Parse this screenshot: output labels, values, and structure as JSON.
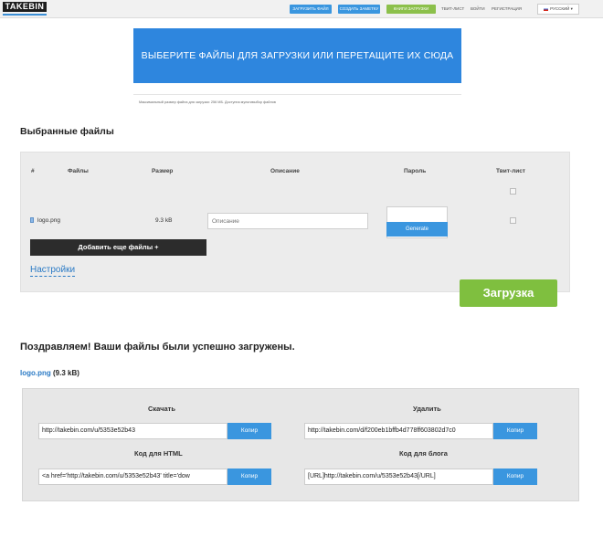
{
  "topbar": {
    "logo_text": "TAKEBIN",
    "btn_upload": "ЗАГРУЗИТЬ ФАЙЛ",
    "btn_create_note": "СОЗДАТЬ ЗАМЕТКУ",
    "btn_green": "КНИГИ ЗАГРУЗКИ",
    "link_tweet": "ТВИТ-ЛИСТ",
    "link_login": "ВОЙТИ",
    "link_register": "РЕГИСТРАЦИЯ",
    "language": "РУССКИЙ ▾"
  },
  "upload": {
    "dropzone_label": "ВЫБЕРИТЕ ФАЙЛЫ ДЛЯ ЗАГРУЗКИ ИЛИ ПЕРЕТАЩИТЕ ИХ СЮДА",
    "note": "Максимальный размер файла для загрузки: 256 МБ. Доступна мультивыбор файлов"
  },
  "selected": {
    "title": "Выбранные файлы",
    "headers": {
      "num": "#",
      "files": "Файлы",
      "size": "Размер",
      "description": "Описание",
      "password": "Пароль",
      "tweet": "Твит-лист"
    },
    "rows": [
      {
        "name": "logo.png",
        "size": "9.3 kB",
        "description_placeholder": "Описание",
        "generate_label": "Generate"
      }
    ],
    "add_more": "Добавить еще файлы +",
    "settings": "Настройки"
  },
  "upload_button": "Загрузка",
  "result": {
    "title": "Поздравляем! Ваши файлы были успешно загружены.",
    "file_name": "logo.png",
    "file_size": "(9.3 kB)",
    "download_label": "Скачать",
    "download_value": "http://takebin.com/u/5353e52b43",
    "delete_label": "Удалить",
    "delete_value": "http://takebin.com/d/f200eb1bffb4d778ff603802d7c0",
    "html_label": "Код для HTML",
    "html_value": "<a href='http://takebin.com/u/5353e52b43' title='dow",
    "blog_label": "Код для блога",
    "blog_value": "[URL]http://takebin.com/u/5353e52b43[/URL]",
    "copy_label": "Копир"
  },
  "colors": {
    "accent_blue": "#2e86de",
    "button_blue": "#3a96df",
    "upload_green": "#7fbf3f",
    "dark_button": "#2c2c2c"
  }
}
